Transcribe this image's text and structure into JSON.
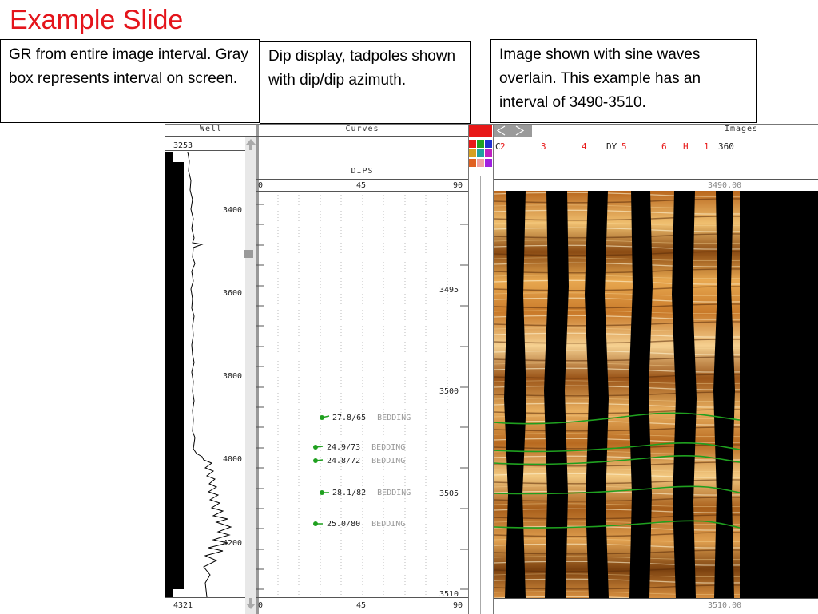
{
  "slide": {
    "title": "Example Slide",
    "callouts": [
      {
        "text": "GR from entire image interval. Gray box represents interval on screen."
      },
      {
        "text": "Dip display, tadpoles shown with dip/dip azimuth."
      },
      {
        "text": "Image shown with sine waves overlain.  This example has an interval of 3490-3510."
      }
    ]
  },
  "well_track": {
    "header": "Well",
    "top_depth": "3253",
    "bottom_depth": "4321",
    "depth_ticks": [
      "3400",
      "3600",
      "3800",
      "4000",
      "4200"
    ]
  },
  "curves_track": {
    "header": "Curves",
    "dips_label": "DIPS",
    "scale": [
      "0",
      "45",
      "90"
    ],
    "depth_ticks": [
      "3495",
      "3500",
      "3505",
      "3510"
    ],
    "dips": [
      {
        "label": "27.8/65",
        "type": "BEDDING"
      },
      {
        "label": "24.9/73",
        "type": "BEDDING"
      },
      {
        "label": "24.8/72",
        "type": "BEDDING"
      },
      {
        "label": "28.1/82",
        "type": "BEDDING"
      },
      {
        "label": "25.0/80",
        "type": "BEDDING"
      }
    ]
  },
  "images_track": {
    "header": "Images",
    "nav_arrows": "<>",
    "pad_labels": [
      "C",
      "2",
      "3",
      "4",
      "DY",
      "5",
      "6",
      "H",
      "1",
      "360"
    ],
    "top_depth": "3490.00",
    "bottom_depth": "3510.00"
  },
  "colors": {
    "title_red": "#e4141b",
    "sine_green": "#1fa01f",
    "image_orange": "#c97a2a",
    "pad_red": "#e81818",
    "swatches": [
      "#e81818",
      "#20a020",
      "#2030d0",
      "#d8a020",
      "#20a0a0",
      "#c020c0",
      "#e06020",
      "#f0a0a0",
      "#a020e0"
    ]
  }
}
